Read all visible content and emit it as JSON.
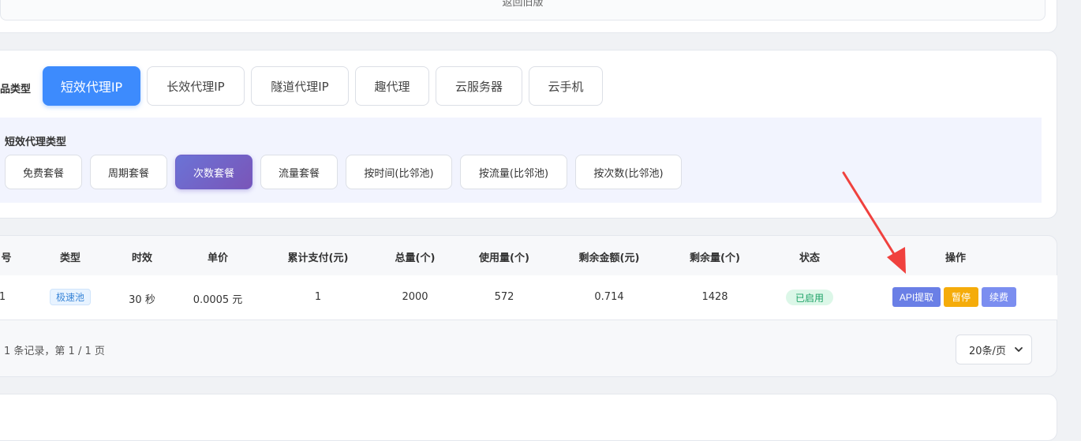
{
  "top_card": {
    "back_old_label": "返回旧版"
  },
  "product": {
    "label": "品类型",
    "tabs": [
      {
        "label": "短效代理IP",
        "active": true
      },
      {
        "label": "长效代理IP",
        "active": false
      },
      {
        "label": "隧道代理IP",
        "active": false
      },
      {
        "label": "趣代理",
        "active": false
      },
      {
        "label": "云服务器",
        "active": false
      },
      {
        "label": "云手机",
        "active": false
      }
    ]
  },
  "sub_type": {
    "label": "短效代理类型",
    "tabs": [
      {
        "label": "免费套餐",
        "active": false
      },
      {
        "label": "周期套餐",
        "active": false
      },
      {
        "label": "次数套餐",
        "active": true
      },
      {
        "label": "流量套餐",
        "active": false
      },
      {
        "label": "按时间(比邻池)",
        "active": false
      },
      {
        "label": "按流量(比邻池)",
        "active": false
      },
      {
        "label": "按次数(比邻池)",
        "active": false
      }
    ]
  },
  "table": {
    "headers": [
      "号",
      "类型",
      "时效",
      "单价",
      "累计支付(元)",
      "总量(个)",
      "使用量(个)",
      "剩余金额(元)",
      "剩余量(个)",
      "状态",
      "操作"
    ],
    "rows": [
      {
        "id": "1",
        "type_tag": "极速池",
        "duration": "30 秒",
        "unit_price": "0.0005 元",
        "total_paid": "1",
        "total": "2000",
        "used": "572",
        "remaining_amount": "0.714",
        "remaining": "1428",
        "status": "已启用",
        "actions": {
          "api": "API提取",
          "pause": "暂停",
          "renew": "续费"
        }
      }
    ]
  },
  "pagination": {
    "summary": "1 条记录，第 1 / 1 页",
    "page_size": "20条/页"
  },
  "colors": {
    "primary_blue": "#3d8bfd",
    "sub_active": "#6b73d6",
    "status_green": "#1ea267",
    "pause_orange": "#f5ac0a",
    "arrow_red": "#f0413e"
  }
}
